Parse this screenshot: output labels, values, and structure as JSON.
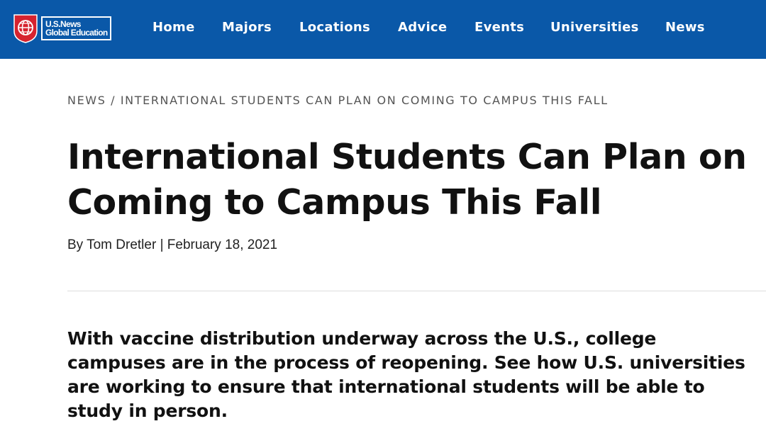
{
  "header": {
    "logo": {
      "line1": "U.S.News",
      "line2": "Global Education",
      "icon": "globe-shield-icon",
      "colors": {
        "shield": "#d6232f",
        "bar": "#0a58a8"
      }
    },
    "nav": [
      {
        "label": "Home"
      },
      {
        "label": "Majors"
      },
      {
        "label": "Locations"
      },
      {
        "label": "Advice"
      },
      {
        "label": "Events"
      },
      {
        "label": "Universities"
      },
      {
        "label": "News"
      }
    ]
  },
  "article": {
    "breadcrumb": {
      "section": "NEWS",
      "separator": " / ",
      "current": "INTERNATIONAL STUDENTS CAN PLAN ON COMING TO CAMPUS THIS FALL"
    },
    "title": "International Students Can Plan on Coming to Campus This Fall",
    "byline": "By Tom Dretler | February 18, 2021",
    "lede": "With vaccine distribution underway across the U.S., college campuses are in the process of reopening. See how U.S. universities are working to ensure that international students will be able to study in person."
  }
}
